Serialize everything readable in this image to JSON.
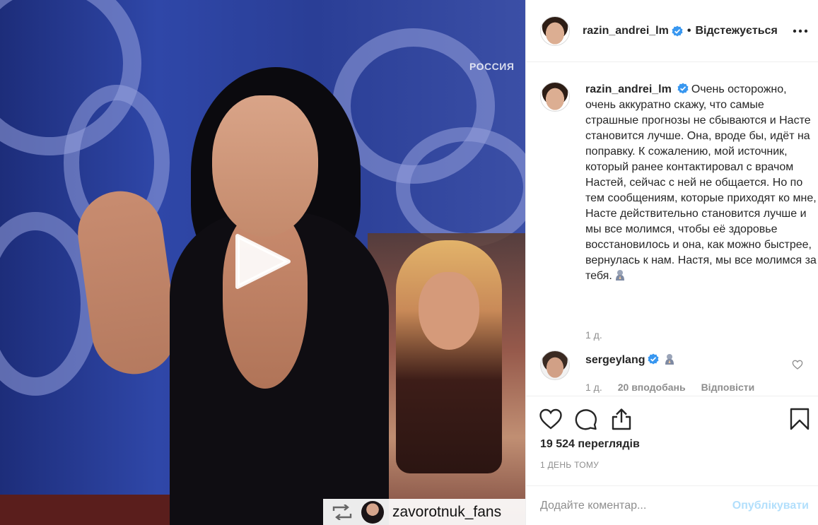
{
  "media": {
    "channel_logo": "РОССИЯ",
    "repost_username": "zavorotnuk_fans"
  },
  "header": {
    "username": "razin_andrei_lm",
    "separator": "•",
    "follow_state": "Відстежується"
  },
  "caption": {
    "username": "razin_andrei_lm",
    "text": "Очень осторожно, очень аккуратно скажу, что самые страшные прогнозы не сбываются и Насте становится лучше. Она, вроде бы, идёт на поправку. К сожалению, мой источник, который ранее контактировал с врачом Настей, сейчас с ней не общается. Но по тем сообщениям, которые приходят ко мне, Насте действительно становится лучше и мы все молимся, чтобы её здоровье восстановилось и она, как можно быстрее, вернулась к нам. Настя, мы все молимся за тебя.",
    "emoji_icon": "praying-emoji-icon",
    "time": "1 д."
  },
  "comment": {
    "username": "sergeylang",
    "emoji_icon": "praying-emoji-icon",
    "time": "1 д.",
    "likes": "20 вподобань",
    "reply": "Відповісти"
  },
  "stats": {
    "views": "19 524 перегля­дів",
    "date": "1 ДЕНЬ ТОМУ"
  },
  "add_comment": {
    "placeholder": "Додайте коментар...",
    "publish_label": "Опублікувати"
  },
  "colors": {
    "verified": "#3897f0",
    "link_disabled": "#b2dffc",
    "muted_text": "#8e8e8e"
  },
  "icons": [
    "more-icon",
    "verified-icon",
    "play-icon",
    "repost-icon",
    "heart-icon",
    "comment-icon",
    "share-icon",
    "bookmark-icon"
  ]
}
